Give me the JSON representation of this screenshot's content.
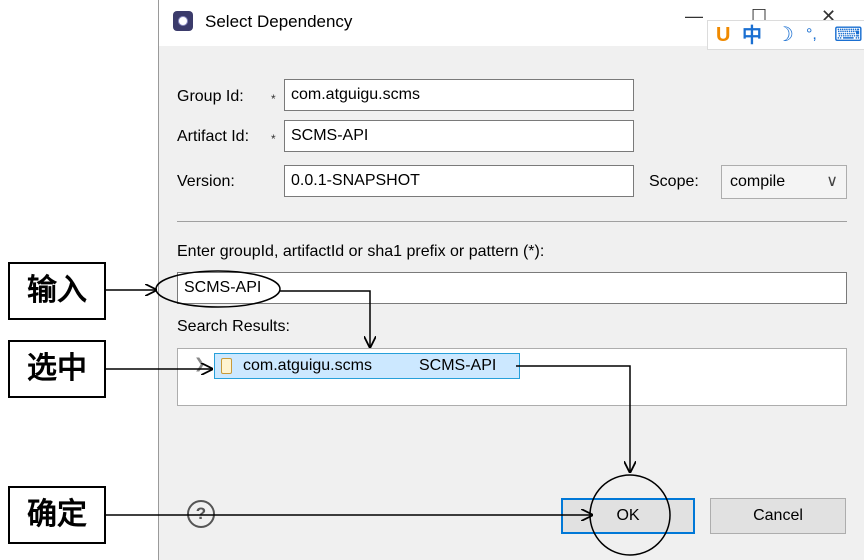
{
  "dialog": {
    "title": "Select Dependency",
    "minimize_glyph": "—",
    "maximize_glyph": "☐",
    "close_glyph": "✕"
  },
  "ime": {
    "logo_glyph": "U",
    "mode": "中",
    "moon_glyph": "☽",
    "punct_glyph": "°,",
    "keyboard_glyph": "⌨"
  },
  "form": {
    "group_id_label": "Group Id:",
    "group_id_value": "com.atguigu.scms",
    "artifact_id_label": "Artifact Id:",
    "artifact_id_value": "SCMS-API",
    "version_label": "Version:",
    "version_value": "0.0.1-SNAPSHOT",
    "scope_label": "Scope:",
    "scope_value": "compile",
    "required_marker": "*"
  },
  "search": {
    "prompt_label": "Enter groupId, artifactId or sha1 prefix or pattern (*):",
    "query": "SCMS-API",
    "results_label": "Search Results:",
    "results": [
      {
        "group": "com.atguigu.scms",
        "artifact": "SCMS-API"
      }
    ]
  },
  "buttons": {
    "help_glyph": "?",
    "ok": "OK",
    "cancel": "Cancel"
  },
  "annotations": {
    "input": "输入",
    "select": "选中",
    "confirm": "确定"
  },
  "colors": {
    "selection_bg": "#cce8ff",
    "selection_border": "#26a0da",
    "default_button_border": "#0078d7"
  }
}
